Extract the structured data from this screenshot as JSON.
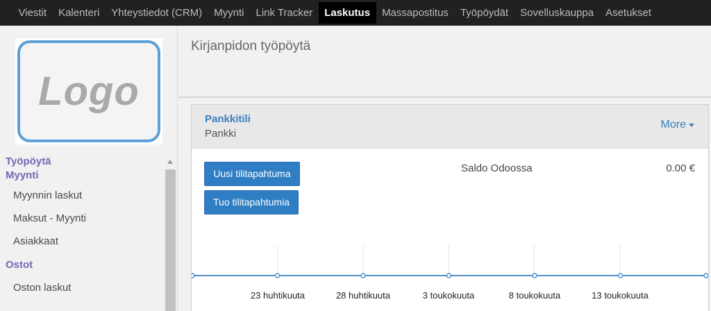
{
  "nav": {
    "items": [
      "Viestit",
      "Kalenteri",
      "Yhteystiedot (CRM)",
      "Myynti",
      "Link Tracker",
      "Laskutus",
      "Massapostitus",
      "Työpöydät",
      "Sovelluskauppa",
      "Asetukset"
    ],
    "active": "Laskutus"
  },
  "sidebar": {
    "logo_text": "Logo",
    "menu": [
      {
        "type": "section",
        "label": "Työpöytä"
      },
      {
        "type": "section",
        "label": "Myynti"
      },
      {
        "type": "item",
        "label": "Myynnin laskut"
      },
      {
        "type": "item",
        "label": "Maksut - Myynti"
      },
      {
        "type": "item",
        "label": "Asiakkaat"
      },
      {
        "type": "section",
        "label": "Ostot"
      },
      {
        "type": "item",
        "label": "Oston laskut"
      }
    ]
  },
  "main": {
    "title": "Kirjanpidon työpöytä",
    "card": {
      "title": "Pankkitili",
      "subtitle": "Pankki",
      "more_label": "More",
      "buttons": {
        "new_transaction": "Uusi tilitapahtuma",
        "import_transactions": "Tuo tilitapahtumia"
      },
      "saldo_label": "Saldo Odoossa",
      "saldo_value": "0.00 €"
    }
  },
  "colors": {
    "accent": "#2f7ec4",
    "link": "#3a7fc1",
    "section": "#7468b4",
    "nav_bg": "#212121",
    "line": "#4f8fc5"
  },
  "chart_data": {
    "type": "line",
    "x": [
      "23 huhtikuuta",
      "28 huhtikuuta",
      "3 toukokuuta",
      "8 toukokuuta",
      "13 toukokuuta"
    ],
    "series": [
      {
        "values": [
          0,
          0,
          0,
          0,
          0,
          0,
          0,
          0,
          0,
          0
        ]
      }
    ]
  }
}
